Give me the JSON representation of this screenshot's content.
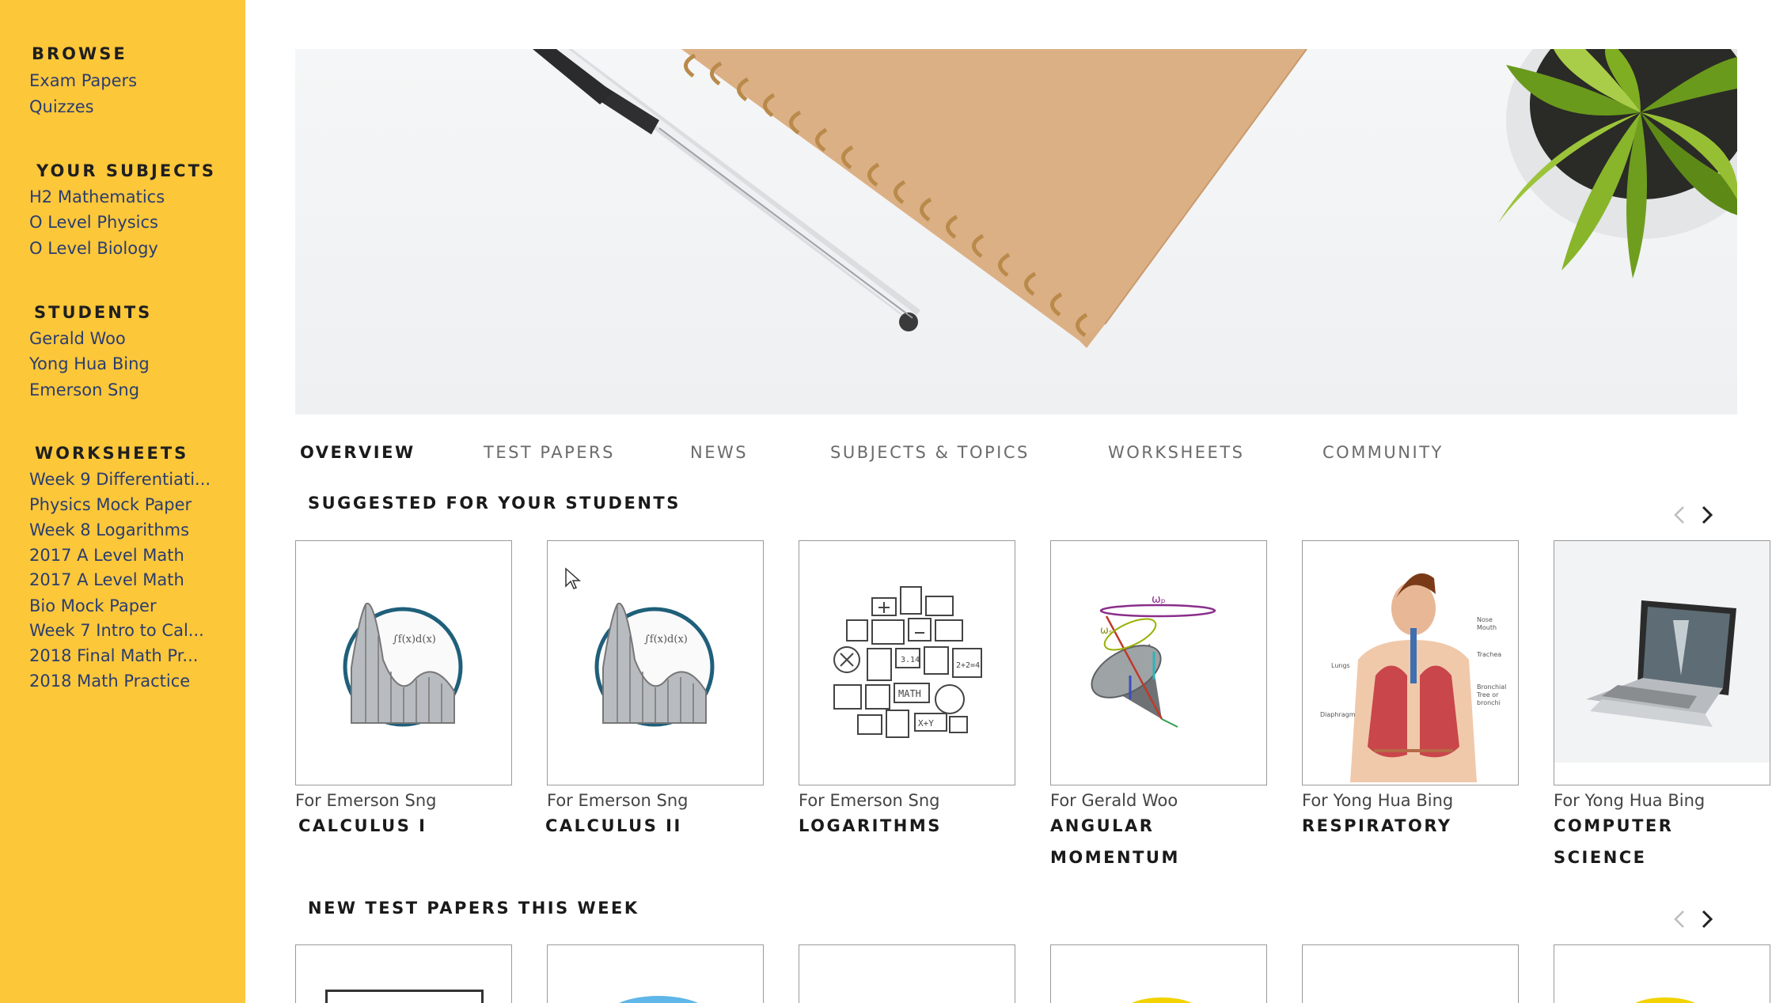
{
  "sidebar": {
    "browse": {
      "heading": "BROWSE",
      "items": [
        "Exam Papers",
        "Quizzes"
      ]
    },
    "subjects": {
      "heading": "YOUR SUBJECTS",
      "items": [
        "H2 Mathematics",
        "O Level Physics",
        "O Level Biology"
      ]
    },
    "students": {
      "heading": "STUDENTS",
      "items": [
        "Gerald Woo",
        "Yong Hua Bing",
        "Emerson Sng"
      ]
    },
    "worksheets": {
      "heading": "WORKSHEETS",
      "items": [
        "Week 9 Differentiati...",
        "Physics Mock Paper",
        "Week 8 Logarithms",
        "2017 A Level Math",
        "2017 A Level Math",
        "Bio Mock Paper",
        "Week 7 Intro to Cal...",
        "2018 Final Math Pr...",
        "2018 Math Practice"
      ]
    }
  },
  "tabs": [
    "OVERVIEW",
    "TEST PAPERS",
    "NEWS",
    "SUBJECTS & TOPICS",
    "WORKSHEETS",
    "COMMUNITY"
  ],
  "suggested": {
    "title": "SUGGESTED FOR YOUR STUDENTS",
    "cards": [
      {
        "for": "For Emerson Sng",
        "title": "CALCULUS I",
        "icon": "calculus-integral-icon"
      },
      {
        "for": "For Emerson Sng",
        "title": "CALCULUS II",
        "icon": "calculus-integral-icon"
      },
      {
        "for": "For Emerson Sng",
        "title": "LOGARITHMS",
        "icon": "math-symbols-collage-icon"
      },
      {
        "for": "For Gerald Woo",
        "title": "ANGULAR MOMENTUM",
        "icon": "spinning-top-icon"
      },
      {
        "for": "For Yong Hua Bing",
        "title": "RESPIRATORY",
        "icon": "lungs-diagram-icon"
      },
      {
        "for": "For Yong Hua Bing",
        "title": "COMPUTER SCIENCE",
        "icon": "laptop-icon"
      }
    ]
  },
  "new_tests": {
    "title": "NEW TEST PAPERS THIS WEEK"
  },
  "images": {
    "calc_formula": "∫f(x)d(x)",
    "top_omega_p": "ωₚ",
    "top_omega_s": "ωₛ",
    "lung_labels": [
      "Nose",
      "Mouth",
      "Trachea",
      "Lungs",
      "Bronchial",
      "Tree or",
      "bronchi",
      "Diaphragm"
    ],
    "log_tiles": [
      "2+2=4",
      "3.14",
      "MATH",
      "X+Y"
    ]
  },
  "colors": {
    "sidebar_bg": "#FDC73A",
    "link": "#2a3d6e",
    "accent_circle": "#1f5f7a"
  }
}
